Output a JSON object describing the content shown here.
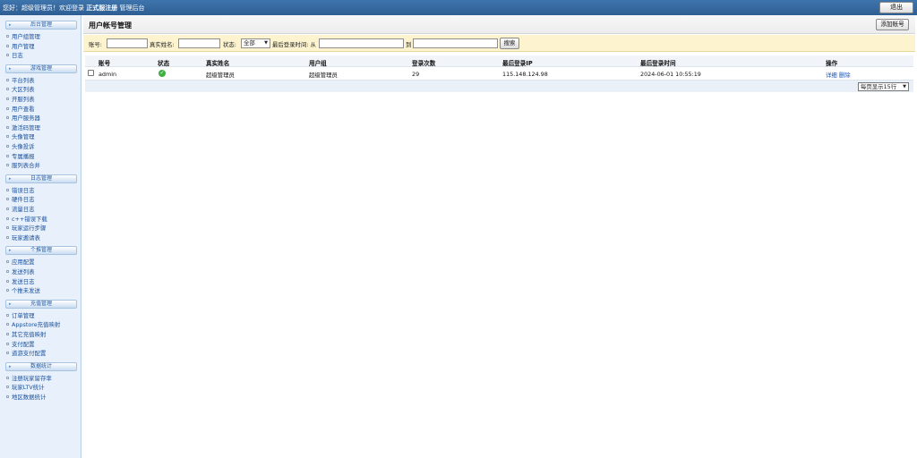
{
  "topbar": {
    "welcome_prefix": "您好：超级管理员！欢迎登录",
    "server": "正式服注册",
    "system": "管理后台",
    "logout_label": "退出"
  },
  "sidebar": {
    "sections": [
      {
        "title": "后台管理",
        "items": [
          "用户组管理",
          "用户管理",
          "日志"
        ]
      },
      {
        "title": "游戏管理",
        "items": [
          "平台列表",
          "大区列表",
          "开服列表",
          "用户查看",
          "用户服务器",
          "激活码管理",
          "头像管理",
          "头像投诉",
          "专属播报",
          "服列表合并"
        ]
      },
      {
        "title": "日志管理",
        "items": [
          "错误日志",
          "硬件日志",
          "流量日志",
          "c++错误下载",
          "玩家运行步骤",
          "玩家邀请表"
        ]
      },
      {
        "title": "个推管理",
        "items": [
          "应用配置",
          "发送列表",
          "发送日志",
          "个推未发送"
        ]
      },
      {
        "title": "充值管理",
        "items": [
          "订单管理",
          "Appstore充值映射",
          "其它充值映射",
          "支付配置",
          "道游支付配置"
        ]
      },
      {
        "title": "数据统计",
        "items": [
          "注册玩家留存率",
          "玩家LTV统计",
          "地区数据统计"
        ]
      }
    ]
  },
  "panel": {
    "title": "用户帐号管理",
    "add_label": "添加帐号"
  },
  "filter": {
    "account_label": "账号:",
    "account_value": "",
    "realname_label": "真实姓名:",
    "realname_value": "",
    "status_label": "状态:",
    "status_selected": "全部",
    "lastlogin_label": "最后登录时间: 从",
    "to_label": "到",
    "from_value": "",
    "to_value": "",
    "search_label": "搜索"
  },
  "table": {
    "columns": [
      "账号",
      "状态",
      "真实姓名",
      "用户组",
      "登录次数",
      "最后登录IP",
      "最后登录时间",
      "操作"
    ],
    "rows": [
      {
        "account": "admin",
        "status": "ok",
        "realname": "超级管理员",
        "group": "超级管理员",
        "logins": "29",
        "ip": "115.148.124.98",
        "time": "2024-06-01 10:55:19",
        "detail": "详细",
        "delete": "删除"
      }
    ],
    "per_page": "每页显示15行"
  },
  "colors": {
    "topbar": "#2e5e93",
    "sidebar_bg": "#e8f1fb",
    "filter_bg": "#fdf4cf",
    "link": "#1a55b8",
    "status_ok": "#3fae45"
  }
}
